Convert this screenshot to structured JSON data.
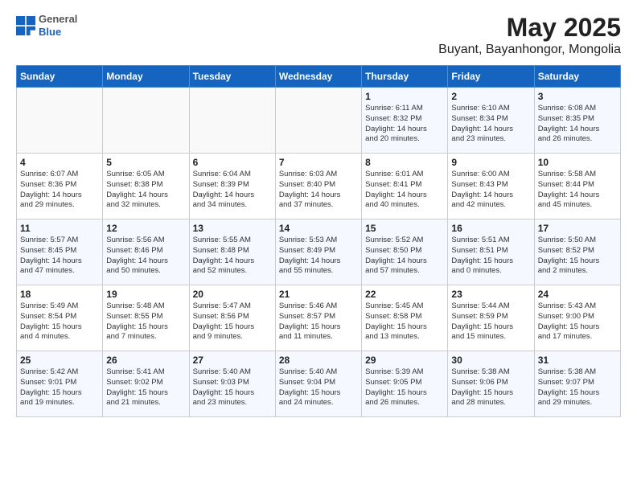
{
  "app": {
    "logo_line1": "General",
    "logo_line2": "Blue",
    "title": "May 2025",
    "subtitle": "Buyant, Bayanhongor, Mongolia"
  },
  "headers": [
    "Sunday",
    "Monday",
    "Tuesday",
    "Wednesday",
    "Thursday",
    "Friday",
    "Saturday"
  ],
  "weeks": [
    [
      {
        "day": "",
        "text": ""
      },
      {
        "day": "",
        "text": ""
      },
      {
        "day": "",
        "text": ""
      },
      {
        "day": "",
        "text": ""
      },
      {
        "day": "1",
        "text": "Sunrise: 6:11 AM\nSunset: 8:32 PM\nDaylight: 14 hours\nand 20 minutes."
      },
      {
        "day": "2",
        "text": "Sunrise: 6:10 AM\nSunset: 8:34 PM\nDaylight: 14 hours\nand 23 minutes."
      },
      {
        "day": "3",
        "text": "Sunrise: 6:08 AM\nSunset: 8:35 PM\nDaylight: 14 hours\nand 26 minutes."
      }
    ],
    [
      {
        "day": "4",
        "text": "Sunrise: 6:07 AM\nSunset: 8:36 PM\nDaylight: 14 hours\nand 29 minutes."
      },
      {
        "day": "5",
        "text": "Sunrise: 6:05 AM\nSunset: 8:38 PM\nDaylight: 14 hours\nand 32 minutes."
      },
      {
        "day": "6",
        "text": "Sunrise: 6:04 AM\nSunset: 8:39 PM\nDaylight: 14 hours\nand 34 minutes."
      },
      {
        "day": "7",
        "text": "Sunrise: 6:03 AM\nSunset: 8:40 PM\nDaylight: 14 hours\nand 37 minutes."
      },
      {
        "day": "8",
        "text": "Sunrise: 6:01 AM\nSunset: 8:41 PM\nDaylight: 14 hours\nand 40 minutes."
      },
      {
        "day": "9",
        "text": "Sunrise: 6:00 AM\nSunset: 8:43 PM\nDaylight: 14 hours\nand 42 minutes."
      },
      {
        "day": "10",
        "text": "Sunrise: 5:58 AM\nSunset: 8:44 PM\nDaylight: 14 hours\nand 45 minutes."
      }
    ],
    [
      {
        "day": "11",
        "text": "Sunrise: 5:57 AM\nSunset: 8:45 PM\nDaylight: 14 hours\nand 47 minutes."
      },
      {
        "day": "12",
        "text": "Sunrise: 5:56 AM\nSunset: 8:46 PM\nDaylight: 14 hours\nand 50 minutes."
      },
      {
        "day": "13",
        "text": "Sunrise: 5:55 AM\nSunset: 8:48 PM\nDaylight: 14 hours\nand 52 minutes."
      },
      {
        "day": "14",
        "text": "Sunrise: 5:53 AM\nSunset: 8:49 PM\nDaylight: 14 hours\nand 55 minutes."
      },
      {
        "day": "15",
        "text": "Sunrise: 5:52 AM\nSunset: 8:50 PM\nDaylight: 14 hours\nand 57 minutes."
      },
      {
        "day": "16",
        "text": "Sunrise: 5:51 AM\nSunset: 8:51 PM\nDaylight: 15 hours\nand 0 minutes."
      },
      {
        "day": "17",
        "text": "Sunrise: 5:50 AM\nSunset: 8:52 PM\nDaylight: 15 hours\nand 2 minutes."
      }
    ],
    [
      {
        "day": "18",
        "text": "Sunrise: 5:49 AM\nSunset: 8:54 PM\nDaylight: 15 hours\nand 4 minutes."
      },
      {
        "day": "19",
        "text": "Sunrise: 5:48 AM\nSunset: 8:55 PM\nDaylight: 15 hours\nand 7 minutes."
      },
      {
        "day": "20",
        "text": "Sunrise: 5:47 AM\nSunset: 8:56 PM\nDaylight: 15 hours\nand 9 minutes."
      },
      {
        "day": "21",
        "text": "Sunrise: 5:46 AM\nSunset: 8:57 PM\nDaylight: 15 hours\nand 11 minutes."
      },
      {
        "day": "22",
        "text": "Sunrise: 5:45 AM\nSunset: 8:58 PM\nDaylight: 15 hours\nand 13 minutes."
      },
      {
        "day": "23",
        "text": "Sunrise: 5:44 AM\nSunset: 8:59 PM\nDaylight: 15 hours\nand 15 minutes."
      },
      {
        "day": "24",
        "text": "Sunrise: 5:43 AM\nSunset: 9:00 PM\nDaylight: 15 hours\nand 17 minutes."
      }
    ],
    [
      {
        "day": "25",
        "text": "Sunrise: 5:42 AM\nSunset: 9:01 PM\nDaylight: 15 hours\nand 19 minutes."
      },
      {
        "day": "26",
        "text": "Sunrise: 5:41 AM\nSunset: 9:02 PM\nDaylight: 15 hours\nand 21 minutes."
      },
      {
        "day": "27",
        "text": "Sunrise: 5:40 AM\nSunset: 9:03 PM\nDaylight: 15 hours\nand 23 minutes."
      },
      {
        "day": "28",
        "text": "Sunrise: 5:40 AM\nSunset: 9:04 PM\nDaylight: 15 hours\nand 24 minutes."
      },
      {
        "day": "29",
        "text": "Sunrise: 5:39 AM\nSunset: 9:05 PM\nDaylight: 15 hours\nand 26 minutes."
      },
      {
        "day": "30",
        "text": "Sunrise: 5:38 AM\nSunset: 9:06 PM\nDaylight: 15 hours\nand 28 minutes."
      },
      {
        "day": "31",
        "text": "Sunrise: 5:38 AM\nSunset: 9:07 PM\nDaylight: 15 hours\nand 29 minutes."
      }
    ]
  ]
}
